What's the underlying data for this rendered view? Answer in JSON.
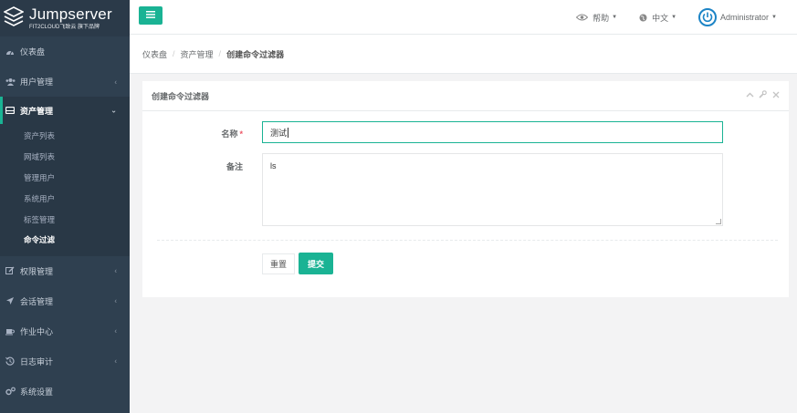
{
  "brand": {
    "title": "Jumpserver",
    "subtitle": "FIT2CLOUD飞致云 旗下品牌"
  },
  "sidebar": {
    "items": [
      {
        "label": "仪表盘",
        "icon": "dashboard-icon",
        "has_children": false
      },
      {
        "label": "用户管理",
        "icon": "users-icon",
        "has_children": true
      },
      {
        "label": "资产管理",
        "icon": "inbox-icon",
        "has_children": true,
        "active": true
      },
      {
        "label": "权限管理",
        "icon": "edit-icon",
        "has_children": true
      },
      {
        "label": "会话管理",
        "icon": "rocket-icon",
        "has_children": true
      },
      {
        "label": "作业中心",
        "icon": "coffee-icon",
        "has_children": true
      },
      {
        "label": "日志审计",
        "icon": "history-icon",
        "has_children": true
      },
      {
        "label": "系统设置",
        "icon": "gears-icon",
        "has_children": false
      }
    ],
    "asset_submenu": [
      "资产列表",
      "网域列表",
      "管理用户",
      "系统用户",
      "标签管理",
      "命令过滤"
    ],
    "current_submenu": "命令过滤"
  },
  "topbar": {
    "help_label": "帮助",
    "language_label": "中文",
    "user_label": "Administrator"
  },
  "breadcrumb": [
    "仪表盘",
    "资产管理",
    "创建命令过滤器"
  ],
  "panel": {
    "title": "创建命令过滤器"
  },
  "form": {
    "name_label": "名称",
    "name_required_mark": "*",
    "name_value": "测试",
    "comment_label": "备注",
    "comment_value": "ls",
    "reset_label": "重置",
    "submit_label": "提交"
  },
  "colors": {
    "sidebar_bg": "#2f4050",
    "accent": "#1ab394",
    "page_bg": "#f3f3f4"
  }
}
